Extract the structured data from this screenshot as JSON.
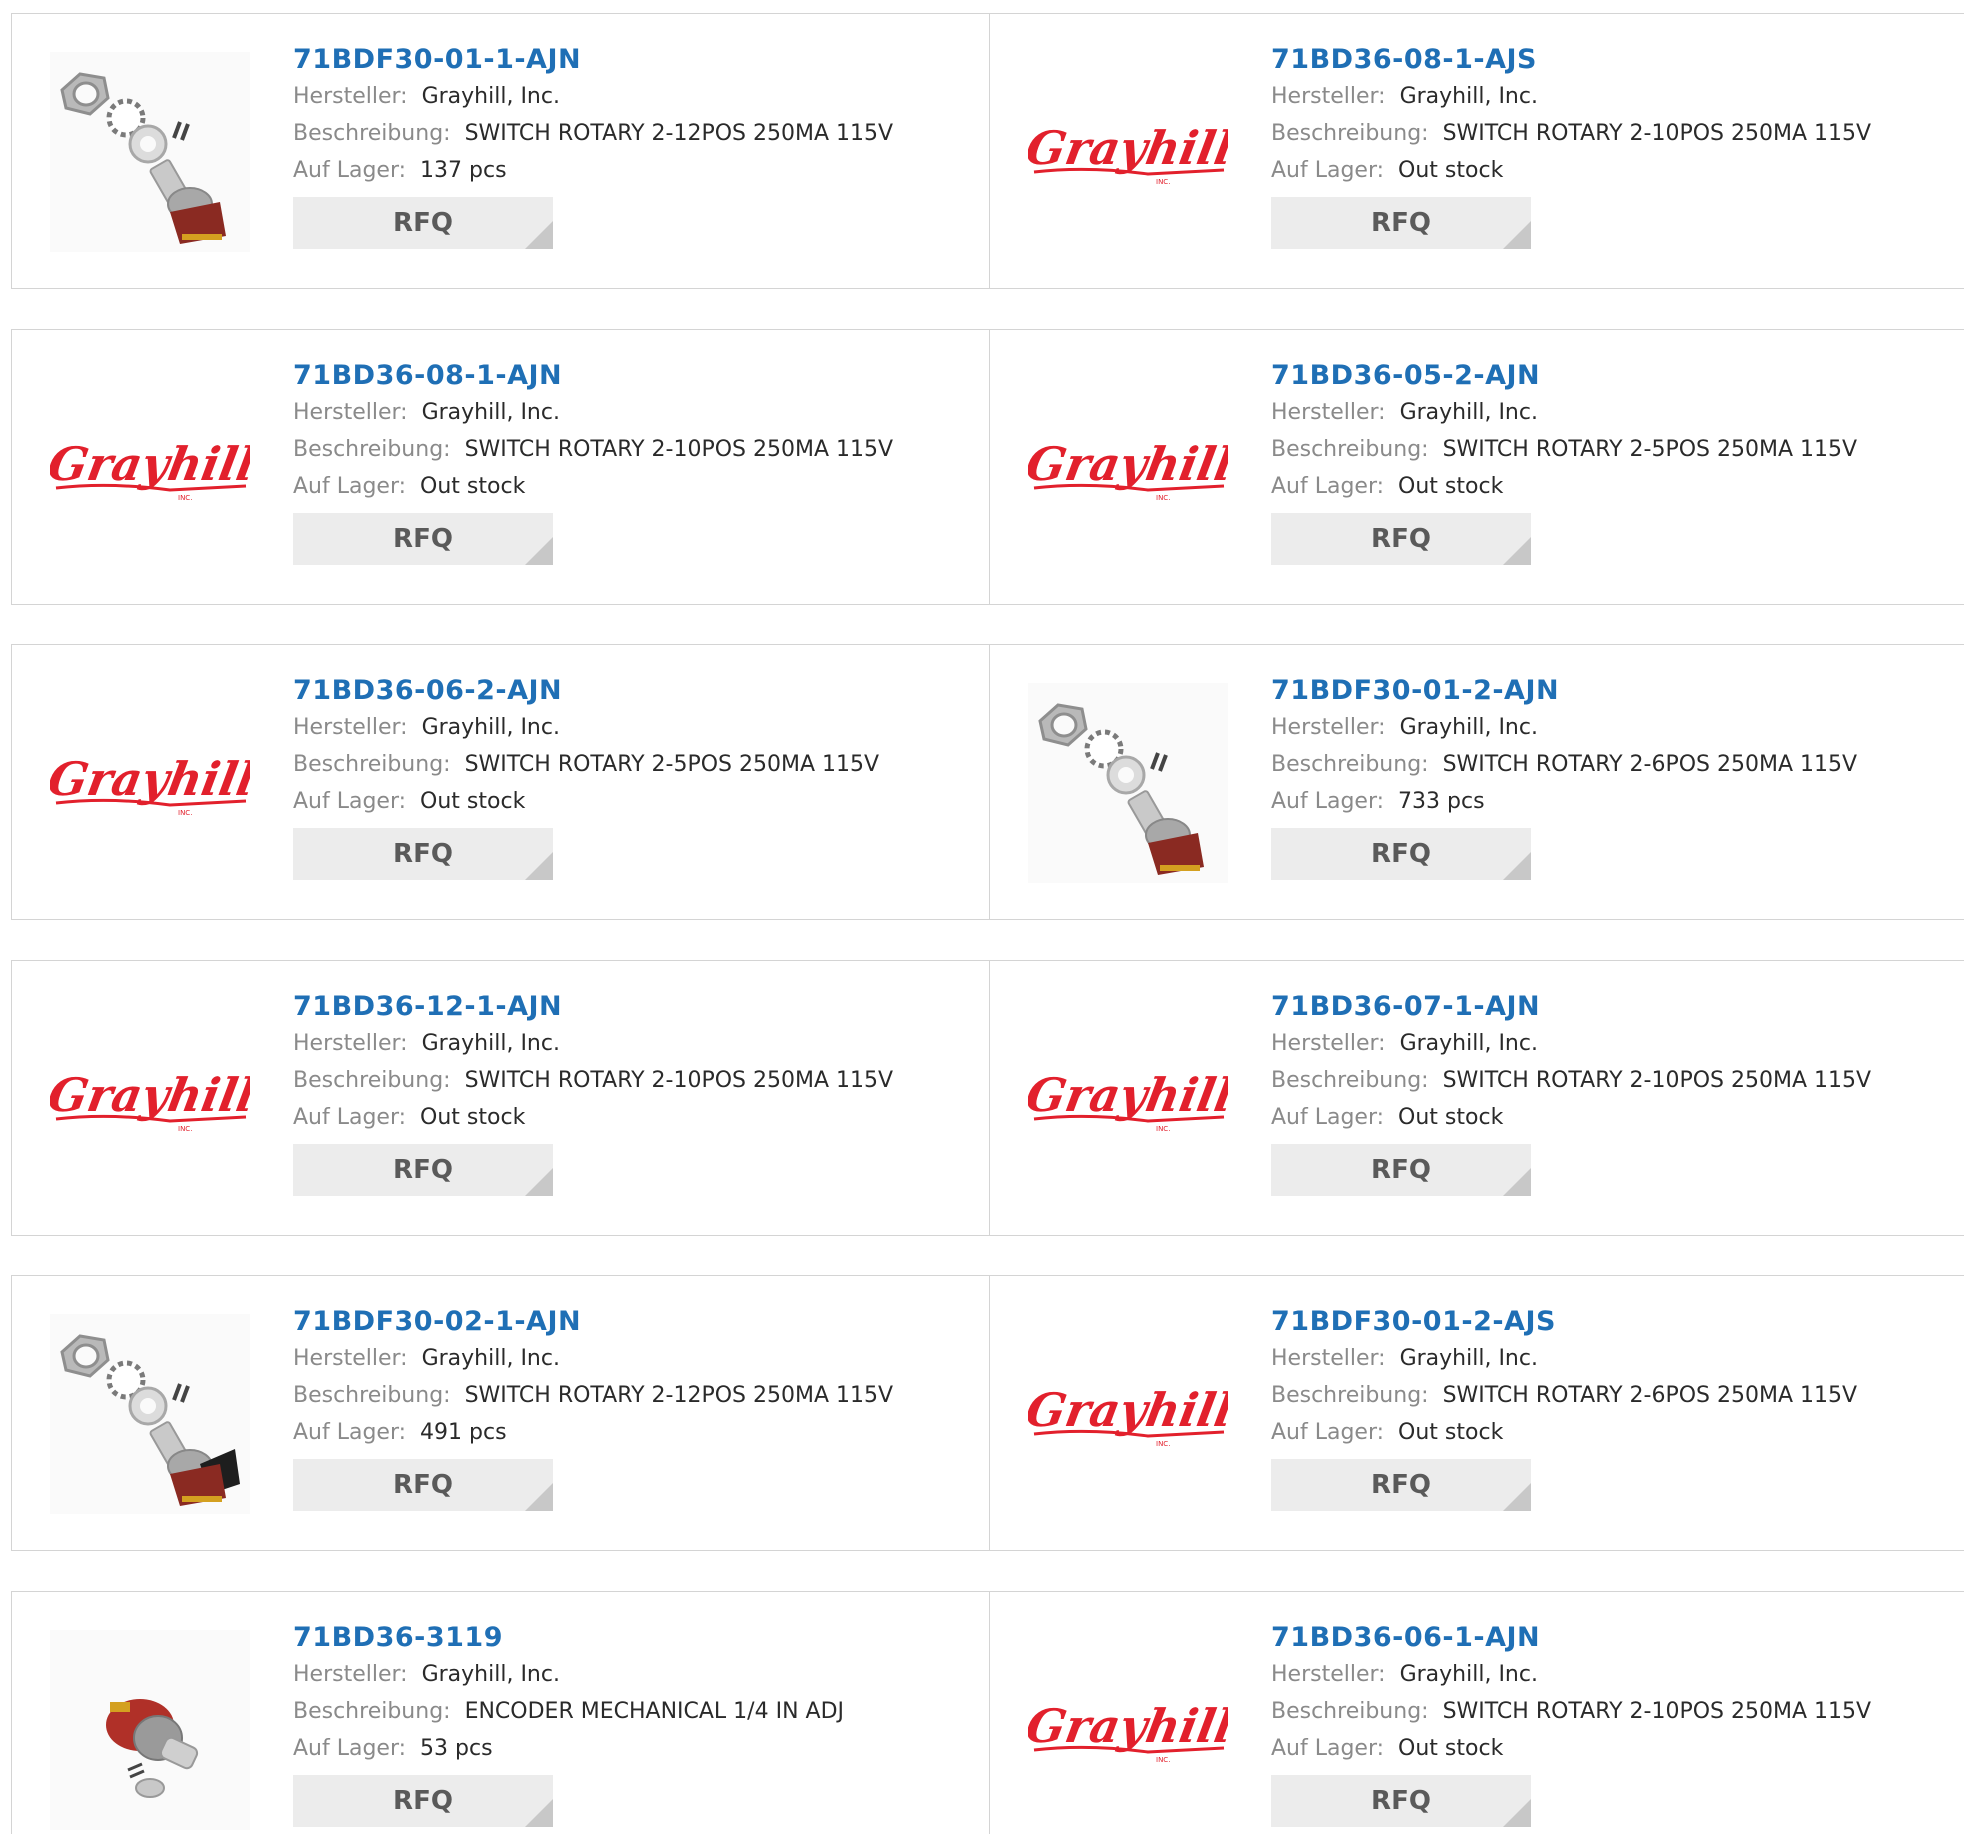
{
  "labels": {
    "manufacturer": "Hersteller:",
    "description": "Beschreibung:",
    "stock": "Auf Lager:",
    "rfq": "RFQ"
  },
  "logo": {
    "text": "Grayhill",
    "sub": "INC.",
    "color": "#e2202c"
  },
  "rows": [
    {
      "left": {
        "part": "71BDF30-01-1-AJN",
        "manufacturer": "Grayhill, Inc.",
        "description": "SWITCH ROTARY 2-12POS 250MA 115V",
        "stock": "137 pcs",
        "image": "rotary-switch-kit"
      },
      "right": {
        "part": "71BD36-08-1-AJS",
        "manufacturer": "Grayhill, Inc.",
        "description": "SWITCH ROTARY 2-10POS 250MA 115V",
        "stock": "Out stock",
        "image": "grayhill-logo"
      }
    },
    {
      "left": {
        "part": "71BD36-08-1-AJN",
        "manufacturer": "Grayhill, Inc.",
        "description": "SWITCH ROTARY 2-10POS 250MA 115V",
        "stock": "Out stock",
        "image": "grayhill-logo"
      },
      "right": {
        "part": "71BD36-05-2-AJN",
        "manufacturer": "Grayhill, Inc.",
        "description": "SWITCH ROTARY 2-5POS 250MA 115V",
        "stock": "Out stock",
        "image": "grayhill-logo"
      }
    },
    {
      "left": {
        "part": "71BD36-06-2-AJN",
        "manufacturer": "Grayhill, Inc.",
        "description": "SWITCH ROTARY 2-5POS 250MA 115V",
        "stock": "Out stock",
        "image": "grayhill-logo"
      },
      "right": {
        "part": "71BDF30-01-2-AJN",
        "manufacturer": "Grayhill, Inc.",
        "description": "SWITCH ROTARY 2-6POS 250MA 115V",
        "stock": "733 pcs",
        "image": "rotary-switch-kit"
      }
    },
    {
      "left": {
        "part": "71BD36-12-1-AJN",
        "manufacturer": "Grayhill, Inc.",
        "description": "SWITCH ROTARY 2-10POS 250MA 115V",
        "stock": "Out stock",
        "image": "grayhill-logo"
      },
      "right": {
        "part": "71BD36-07-1-AJN",
        "manufacturer": "Grayhill, Inc.",
        "description": "SWITCH ROTARY 2-10POS 250MA 115V",
        "stock": "Out stock",
        "image": "grayhill-logo"
      }
    },
    {
      "left": {
        "part": "71BDF30-02-1-AJN",
        "manufacturer": "Grayhill, Inc.",
        "description": "SWITCH ROTARY 2-12POS 250MA 115V",
        "stock": "491 pcs",
        "image": "rotary-switch-kit-black"
      },
      "right": {
        "part": "71BDF30-01-2-AJS",
        "manufacturer": "Grayhill, Inc.",
        "description": "SWITCH ROTARY 2-6POS 250MA 115V",
        "stock": "Out stock",
        "image": "grayhill-logo"
      }
    },
    {
      "left": {
        "part": "71BD36-3119",
        "manufacturer": "Grayhill, Inc.",
        "description": "ENCODER MECHANICAL 1/4 IN ADJ",
        "stock": "53 pcs",
        "image": "rotary-encoder"
      },
      "right": {
        "part": "71BD36-06-1-AJN",
        "manufacturer": "Grayhill, Inc.",
        "description": "SWITCH ROTARY 2-10POS 250MA 115V",
        "stock": "Out stock",
        "image": "grayhill-logo"
      }
    }
  ]
}
